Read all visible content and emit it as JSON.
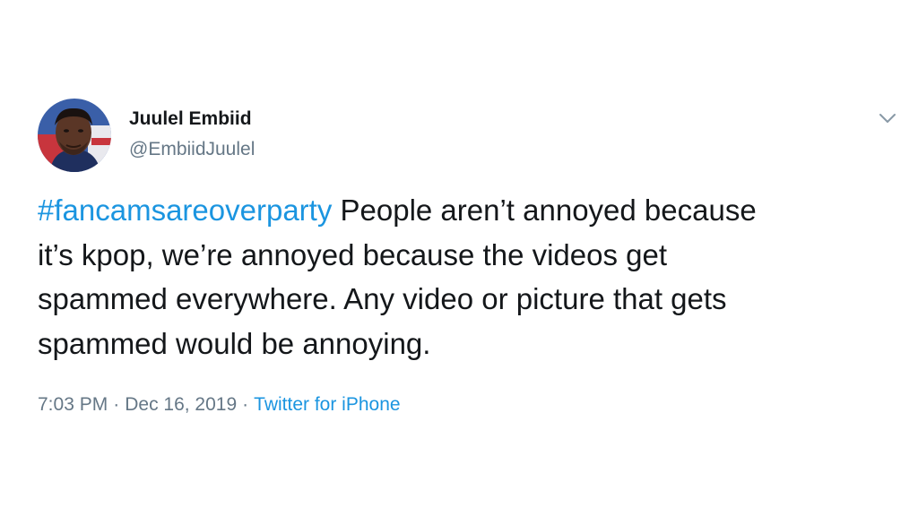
{
  "tweet": {
    "author": {
      "display_name": "Juulel Embiid",
      "handle": "@EmbiidJuulel",
      "avatar_icon": "profile-photo"
    },
    "menu_icon": "chevron-down-icon",
    "text": {
      "hashtag": "#fancamsareoverparty",
      "line1_rest": " People aren’t annoyed because",
      "line2": "it’s kpop, we’re annoyed because the videos get",
      "line3": "spammed everywhere. Any video or picture that gets",
      "line4": "spammed would be annoying."
    },
    "meta": {
      "time": "7:03 PM",
      "separator": "·",
      "date": "Dec 16, 2019",
      "source": "Twitter for iPhone"
    },
    "colors": {
      "text": "#14171a",
      "secondary": "#657786",
      "link": "#1b95e0"
    }
  }
}
